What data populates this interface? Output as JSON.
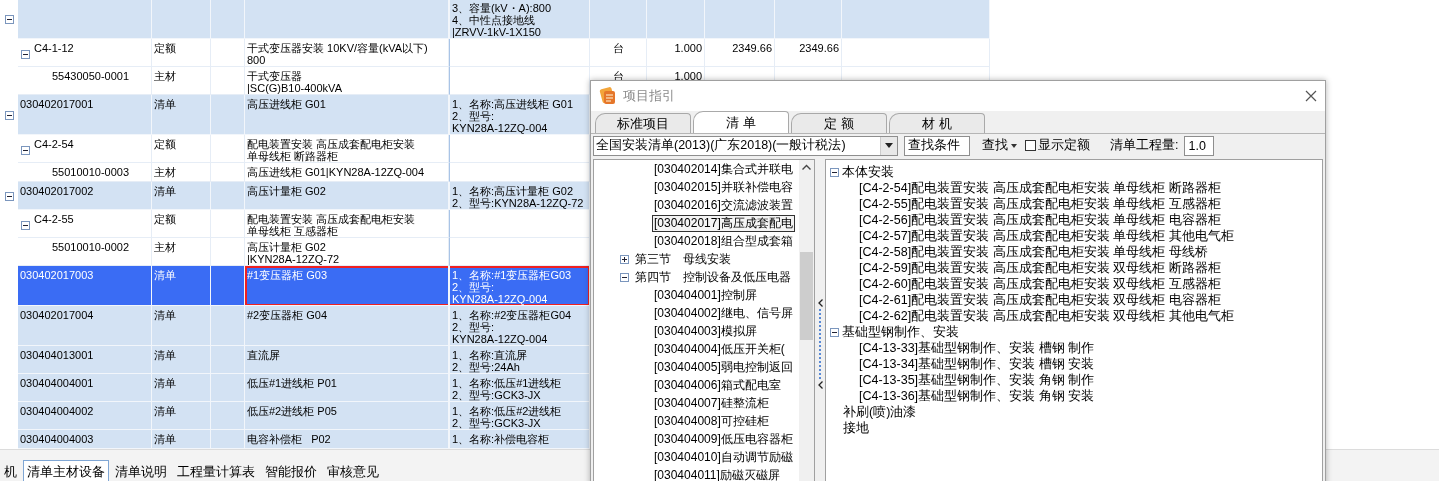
{
  "table": {
    "rows": [
      {
        "kind": "list",
        "feature": [
          "3、容量(kV・A):800",
          "4、中性点接地线",
          "|ZRVV-1kV-1X150"
        ],
        "expanded": true,
        "selected": false,
        "children": [
          {
            "kind": "quota",
            "code": "C4-1-12",
            "type": "定额",
            "name": [
              "干式变压器安装 10KV/容量(kVA以下)",
              "800"
            ],
            "unit": "台",
            "qty": "1.000",
            "price": "2349.66",
            "total": "2349.66",
            "expanded": true,
            "selected": false,
            "children": [
              {
                "kind": "material",
                "code": "55430050-0001",
                "type": "主材",
                "name": [
                  "干式变压器",
                  "|SC(G)B10-400kVA"
                ],
                "unit": "台",
                "qty": "1.000",
                "selected": false
              }
            ]
          }
        ]
      },
      {
        "kind": "list",
        "code": "030402017001",
        "type": "清单",
        "name": [
          "高压进线柜 G01"
        ],
        "feature": [
          "1、名称:高压进线柜 G01",
          "2、型号:",
          "KYN28A-12ZQ-004"
        ],
        "expanded": true,
        "selected": false,
        "children": [
          {
            "kind": "quota",
            "code": "C4-2-54",
            "type": "定额",
            "name": [
              "配电装置安装 高压成套配电柜安装",
              "单母线柜 断路器柜"
            ],
            "expanded": true,
            "selected": false,
            "children": [
              {
                "kind": "material",
                "code": "55010010-0003",
                "type": "主材",
                "name": [
                  "高压进线柜 G01|KYN28A-12ZQ-004"
                ],
                "selected": false
              }
            ]
          }
        ]
      },
      {
        "kind": "list",
        "code": "030402017002",
        "type": "清单",
        "name": [
          "高压计量柜 G02"
        ],
        "feature": [
          "1、名称:高压计量柜 G02",
          "2、型号:KYN28A-12ZQ-72"
        ],
        "expanded": true,
        "selected": false,
        "children": [
          {
            "kind": "quota",
            "code": "C4-2-55",
            "type": "定额",
            "name": [
              "配电装置安装 高压成套配电柜安装",
              "单母线柜 互感器柜"
            ],
            "expanded": true,
            "selected": false,
            "children": [
              {
                "kind": "material",
                "code": "55010010-0002",
                "type": "主材",
                "name": [
                  "高压计量柜 G02",
                  "|KYN28A-12ZQ-72"
                ],
                "selected": false
              }
            ]
          }
        ]
      },
      {
        "kind": "list",
        "code": "030402017003",
        "type": "清单",
        "name": [
          "#1变压器柜 G03"
        ],
        "feature": [
          "1、名称:#1变压器柜G03",
          "2、型号:",
          "KYN28A-12ZQ-004"
        ],
        "selected": true,
        "highlighted": true
      },
      {
        "kind": "list",
        "code": "030402017004",
        "type": "清单",
        "name": [
          "#2变压器柜 G04"
        ],
        "feature": [
          "1、名称:#2变压器柜G04",
          "2、型号:",
          "KYN28A-12ZQ-004"
        ],
        "selected": false
      },
      {
        "kind": "list",
        "code": "030404013001",
        "type": "清单",
        "name": [
          "直流屏"
        ],
        "feature": [
          "1、名称:直流屏",
          "2、型号:24Ah"
        ],
        "selected": false
      },
      {
        "kind": "list",
        "code": "030404004001",
        "type": "清单",
        "name": [
          "低压#1进线柜 P01"
        ],
        "feature": [
          "1、名称:低压#1进线柜",
          "2、型号:GCK3-JX"
        ],
        "selected": false
      },
      {
        "kind": "list",
        "code": "030404004002",
        "type": "清单",
        "name": [
          "低压#2进线柜 P05"
        ],
        "feature": [
          "1、名称:低压#2进线柜",
          "2、型号:GCK3-JX"
        ],
        "selected": false
      },
      {
        "kind": "list",
        "code": "030404004003",
        "type": "清单",
        "name": [
          "电容补偿柜   P02"
        ],
        "feature": [
          "1、名称:补偿电容柜"
        ],
        "selected": false
      }
    ]
  },
  "bottom_tabs": [
    {
      "label": "机",
      "selected": false
    },
    {
      "label": "清单主材设备",
      "selected": true
    },
    {
      "label": "清单说明",
      "selected": false
    },
    {
      "label": "工程量计算表",
      "selected": false
    },
    {
      "label": "智能报价",
      "selected": false
    },
    {
      "label": "审核意见",
      "selected": false
    }
  ],
  "dialog": {
    "title": "项目指引",
    "tabs": [
      {
        "label": "标准项目",
        "selected": false
      },
      {
        "label": "清 单",
        "selected": true
      },
      {
        "label": "定 额",
        "selected": false
      },
      {
        "label": "材 机",
        "selected": false
      }
    ],
    "library": "全国安装清单(2013)(广东2018)(一般计税法)",
    "search_value": "查找条件",
    "search_button": "查找",
    "show_quota": {
      "label": "显示定额",
      "checked": false
    },
    "quantity_label": "清单工程量:",
    "quantity_value": "1.0",
    "left_tree": {
      "continued_items": [
        {
          "label": "[030402014]集合式并联电",
          "selected": false
        },
        {
          "label": "[030402015]并联补偿电容",
          "selected": false
        },
        {
          "label": "[030402016]交流滤波装置",
          "selected": false
        },
        {
          "label": "[030402017]高压成套配电",
          "selected": true
        },
        {
          "label": "[030402018]组合型成套箱",
          "selected": false
        }
      ],
      "nodes": [
        {
          "label": "第三节　母线安装",
          "expanded": false,
          "selected": false
        },
        {
          "label": "第四节　控制设备及低压电器",
          "expanded": true,
          "selected": false,
          "children": [
            {
              "label": "[030404001]控制屏",
              "selected": false
            },
            {
              "label": "[030404002]继电、信号屏",
              "selected": false
            },
            {
              "label": "[030404003]模拟屏",
              "selected": false
            },
            {
              "label": "[030404004]低压开关柜(",
              "selected": false
            },
            {
              "label": "[030404005]弱电控制返回",
              "selected": false
            },
            {
              "label": "[030404006]箱式配电室",
              "selected": false
            },
            {
              "label": "[030404007]硅整流柜",
              "selected": false
            },
            {
              "label": "[030404008]可控硅柜",
              "selected": false
            },
            {
              "label": "[030404009]低压电容器柜",
              "selected": false
            },
            {
              "label": "[030404010]自动调节励磁",
              "selected": false
            },
            {
              "label": "[030404011]励磁灭磁屏",
              "selected": false
            }
          ]
        }
      ]
    },
    "right_tree": [
      {
        "label": "本体安装",
        "expanded": true,
        "children": [
          {
            "label": "[C4-2-54]配电装置安装 高压成套配电柜安装 单母线柜 断路器柜"
          },
          {
            "label": "[C4-2-55]配电装置安装 高压成套配电柜安装 单母线柜 互感器柜"
          },
          {
            "label": "[C4-2-56]配电装置安装 高压成套配电柜安装 单母线柜 电容器柜"
          },
          {
            "label": "[C4-2-57]配电装置安装 高压成套配电柜安装 单母线柜 其他电气柜"
          },
          {
            "label": "[C4-2-58]配电装置安装 高压成套配电柜安装 单母线柜 母线桥"
          },
          {
            "label": "[C4-2-59]配电装置安装 高压成套配电柜安装 双母线柜 断路器柜"
          },
          {
            "label": "[C4-2-60]配电装置安装 高压成套配电柜安装 双母线柜 互感器柜"
          },
          {
            "label": "[C4-2-61]配电装置安装 高压成套配电柜安装 双母线柜 电容器柜"
          },
          {
            "label": "[C4-2-62]配电装置安装 高压成套配电柜安装 双母线柜 其他电气柜"
          }
        ]
      },
      {
        "label": "基础型钢制作、安装",
        "expanded": true,
        "children": [
          {
            "label": "[C4-13-33]基础型钢制作、安装 槽钢 制作"
          },
          {
            "label": "[C4-13-34]基础型钢制作、安装 槽钢 安装"
          },
          {
            "label": "[C4-13-35]基础型钢制作、安装 角钢 制作"
          },
          {
            "label": "[C4-13-36]基础型钢制作、安装 角钢 安装"
          }
        ]
      },
      {
        "label": "补刷(喷)油漆"
      },
      {
        "label": "接地"
      }
    ]
  }
}
